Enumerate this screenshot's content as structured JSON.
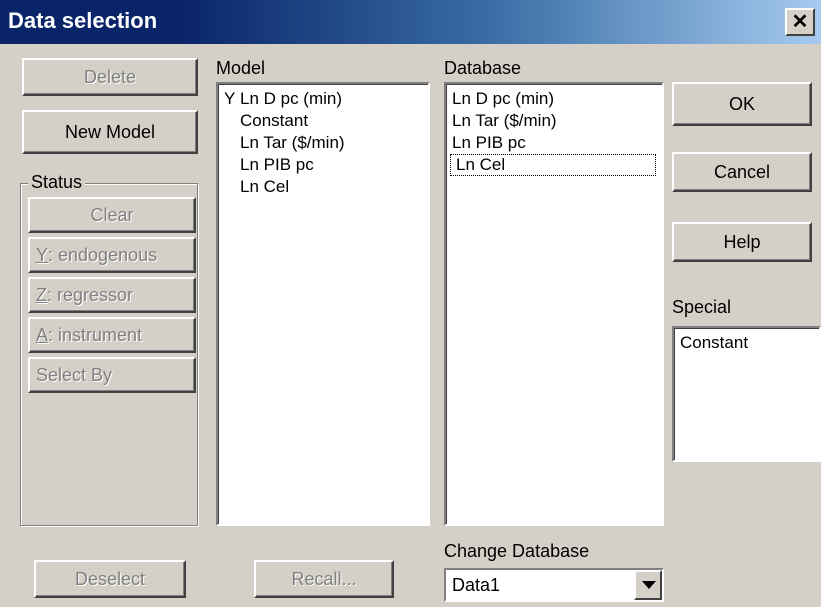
{
  "window": {
    "title": "Data selection"
  },
  "left_buttons": {
    "delete": "Delete",
    "new_model": "New Model"
  },
  "status": {
    "legend": "Status",
    "clear": "Clear",
    "endogenous": ": endogenous",
    "endogenous_key": "Y",
    "regressor": ": regressor",
    "regressor_key": "Z",
    "instrument": ": instrument",
    "instrument_key": "A",
    "select_by": "Select By"
  },
  "model": {
    "label": "Model",
    "rows": [
      {
        "mark": "Y",
        "text": "Ln D pc (min)"
      },
      {
        "mark": "",
        "text": "Constant"
      },
      {
        "mark": "",
        "text": "Ln Tar ($/min)"
      },
      {
        "mark": "",
        "text": "Ln PIB pc"
      },
      {
        "mark": "",
        "text": "Ln Cel"
      }
    ]
  },
  "database": {
    "label": "Database",
    "items": [
      "Ln D pc (min)",
      "Ln Tar ($/min)",
      "Ln PIB pc",
      "Ln Cel"
    ],
    "focused_index": 3
  },
  "right_buttons": {
    "ok": "OK",
    "cancel": "Cancel",
    "help": "Help"
  },
  "special": {
    "label": "Special",
    "items": [
      "Constant"
    ]
  },
  "bottom": {
    "deselect": "Deselect",
    "recall": "Recall...",
    "change_database_label": "Change Database",
    "database_value": "Data1"
  }
}
